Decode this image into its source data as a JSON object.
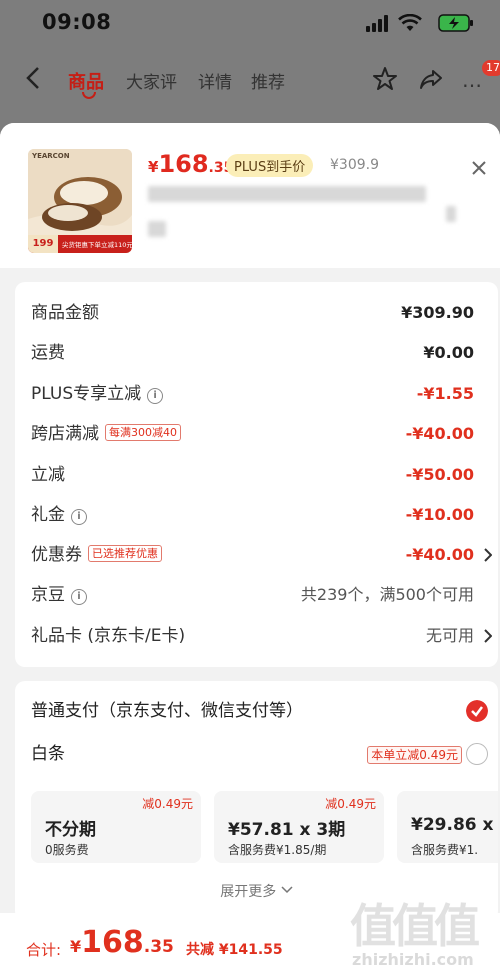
{
  "status_bar": {
    "time": "09:08"
  },
  "nav": {
    "tabs": [
      "商品",
      "大家评",
      "详情",
      "推荐"
    ],
    "badge": "17"
  },
  "product": {
    "thumb_brand": "YEARCON",
    "thumb_price": "199",
    "thumb_note": "尖货钜惠下单立减110元",
    "price_currency": "¥",
    "price_int": "168",
    "price_dec": ".35",
    "plus_tag": "PLUS到手价",
    "original_price": "¥309.9"
  },
  "breakdown": {
    "rows": [
      {
        "label": "商品金额",
        "value": "¥309.90"
      },
      {
        "label": "运费",
        "value": "¥0.00"
      },
      {
        "label": "PLUS专享立减",
        "value": "-¥1.55"
      },
      {
        "label": "跨店满减",
        "tag": "每满300减40",
        "value": "-¥40.00"
      },
      {
        "label": "立减",
        "value": "-¥50.00"
      },
      {
        "label": "礼金",
        "value": "-¥10.00"
      },
      {
        "label": "优惠券",
        "tag": "已选推荐优惠",
        "value": "-¥40.00"
      },
      {
        "label": "京豆",
        "value": "共239个，满500个可用"
      },
      {
        "label": "礼品卡 (京东卡/E卡)",
        "value": "无可用"
      }
    ],
    "info_glyph": "i"
  },
  "payment": {
    "standard_label": "普通支付（京东支付、微信支付等）",
    "baitiao_label": "白条",
    "baitiao_tag": "本单立减0.49元",
    "plans": [
      {
        "discount": "减0.49元",
        "main": "不分期",
        "sub": "0服务费"
      },
      {
        "discount": "减0.49元",
        "main": "¥57.81 x 3期",
        "sub": "含服务费¥1.85/期"
      },
      {
        "discount": "",
        "main": "¥29.86 x",
        "sub": "含服务费¥1."
      }
    ],
    "expand_label": "展开更多"
  },
  "footer": {
    "total_label": "合计:",
    "total_currency": "¥",
    "total_int": "168",
    "total_dec": ".35",
    "saved": "共减 ¥141.55"
  },
  "watermark": {
    "chars": "值值值",
    "url": "zhizhizhi.com"
  },
  "colors": {
    "accent": "#e0301e",
    "plus_tag_bg": "#fbeeb8",
    "sheet_bg": "#f2f2f2"
  }
}
